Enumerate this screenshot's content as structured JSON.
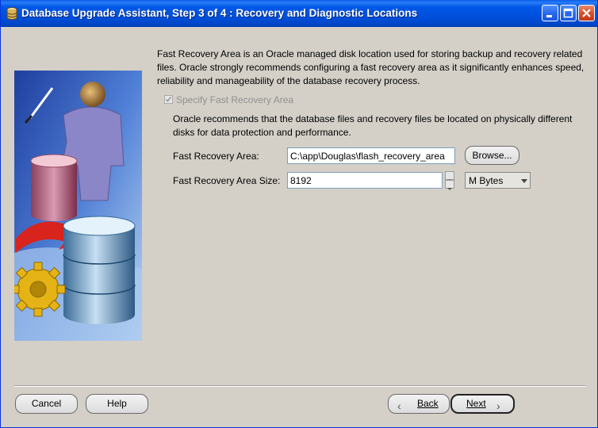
{
  "window": {
    "title": "Database Upgrade Assistant, Step 3 of 4 : Recovery and Diagnostic Locations",
    "icons": {
      "app": "database-icon",
      "minimize": "minimize-icon",
      "maximize": "maximize-icon",
      "close": "close-icon"
    },
    "accent_color": "#0054e3"
  },
  "content": {
    "description": "Fast Recovery Area is an Oracle managed disk location used for storing backup and recovery related files. Oracle strongly recommends configuring a fast recovery area as it significantly enhances speed, reliability and manageability of the database recovery process.",
    "specify_checkbox": {
      "label": "Specify Fast Recovery Area",
      "checked": true,
      "enabled": false
    },
    "recommendation": "Oracle recommends that the database files and recovery files be located on physically different disks for data protection and performance.",
    "fra_location": {
      "label": "Fast Recovery Area:",
      "value": "C:\\app\\Douglas\\flash_recovery_area"
    },
    "browse_label": "Browse...",
    "fra_size": {
      "label": "Fast Recovery Area Size:",
      "value": "8192"
    },
    "size_unit": {
      "selected": "M Bytes"
    }
  },
  "footer": {
    "cancel_label": "Cancel",
    "help_label": "Help",
    "back_label": "Back",
    "next_label": "Next"
  }
}
